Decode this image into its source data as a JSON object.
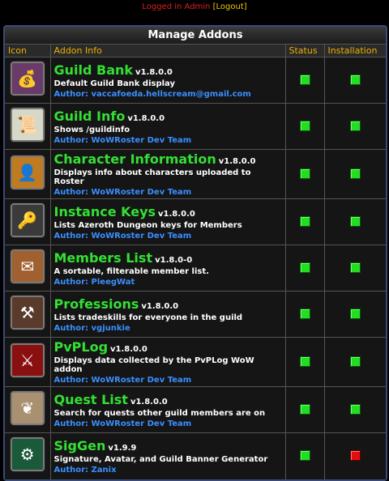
{
  "header": {
    "status_text": "Logged in Admin",
    "bracket_open": "[",
    "logout_label": "Logout",
    "bracket_close": "]"
  },
  "panel": {
    "title": "Manage Addons",
    "columns": [
      "Icon",
      "Addon Info",
      "Status",
      "Installation"
    ]
  },
  "addons": [
    {
      "name": "Guild Bank",
      "version": "v1.8.0.0",
      "description": "Default Guild Bank display",
      "author": "Author: vaccafoeda.hellscream@gmail.com",
      "status": "on",
      "installation": "on",
      "icon": "bank-icon",
      "icon_bg": "#6a3a6a",
      "icon_glyph": "💰"
    },
    {
      "name": "Guild Info",
      "version": "v1.8.0.0",
      "description": "Shows /guildinfo",
      "author": "Author: WoWRoster Dev Team",
      "status": "on",
      "installation": "on",
      "icon": "scroll-icon",
      "icon_bg": "#d8d8c8",
      "icon_glyph": "📜"
    },
    {
      "name": "Character Information",
      "version": "v1.8.0.0",
      "description": "Displays info about characters uploaded to Roster",
      "author": "Author: WoWRoster Dev Team",
      "status": "on",
      "installation": "on",
      "icon": "character-icon",
      "icon_bg": "#c07a20",
      "icon_glyph": "👤"
    },
    {
      "name": "Instance Keys",
      "version": "v1.8.0.0",
      "description": "Lists Azeroth Dungeon keys for Members",
      "author": "Author: WoWRoster Dev Team",
      "status": "on",
      "installation": "on",
      "icon": "key-icon",
      "icon_bg": "#3a3a3a",
      "icon_glyph": "🔑"
    },
    {
      "name": "Members List",
      "version": "v1.8.0-0",
      "description": "A sortable, filterable member list.",
      "author": "Author: PleegWat",
      "status": "on",
      "installation": "on",
      "icon": "letters-icon",
      "icon_bg": "#a06030",
      "icon_glyph": "✉"
    },
    {
      "name": "Professions",
      "version": "v1.8.0.0",
      "description": "Lists tradeskills for everyone in the guild",
      "author": "Author: vgjunkie",
      "status": "on",
      "installation": "on",
      "icon": "tools-icon",
      "icon_bg": "#5a3a2a",
      "icon_glyph": "⚒"
    },
    {
      "name": "PvPLog",
      "version": "v1.8.0.0",
      "description": "Displays data collected by the PvPLog WoW addon",
      "author": "Author: WoWRoster Dev Team",
      "status": "on",
      "installation": "on",
      "icon": "banner-icon",
      "icon_bg": "#8a1010",
      "icon_glyph": "⚔"
    },
    {
      "name": "Quest List",
      "version": "v1.8.0.0",
      "description": "Search for quests other guild members are on",
      "author": "Author: WoWRoster Dev Team",
      "status": "on",
      "installation": "on",
      "icon": "seal-icon",
      "icon_bg": "#a89070",
      "icon_glyph": "❦"
    },
    {
      "name": "SigGen",
      "version": "v1.9.9",
      "description": "Signature, Avatar, and Guild Banner Generator",
      "author": "Author: Zanix",
      "status": "on",
      "installation": "off",
      "icon": "banner-generator-icon",
      "icon_bg": "#1a5a3a",
      "icon_glyph": "⚙"
    }
  ],
  "colors": {
    "on": "#22dd22",
    "off": "#e01010",
    "name": "#33e033",
    "author": "#3a8fff",
    "header_text": "#f0b000"
  }
}
